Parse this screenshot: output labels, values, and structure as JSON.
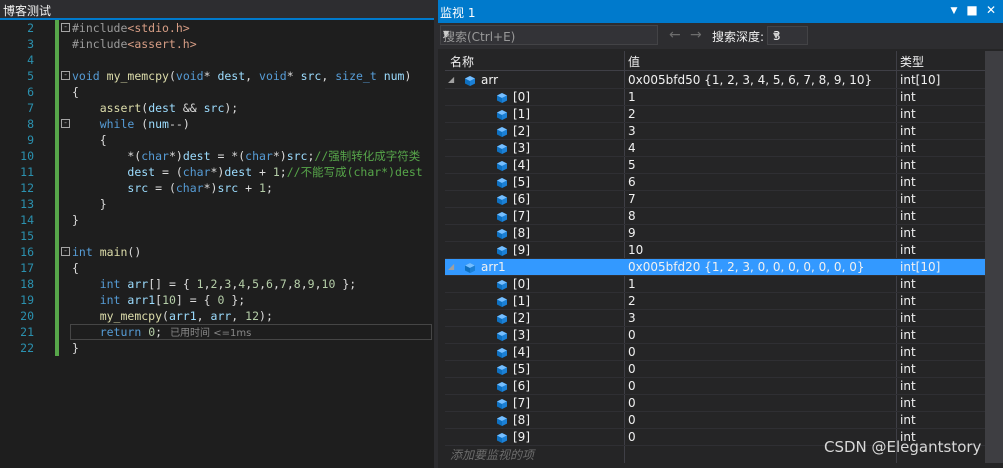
{
  "editor": {
    "tab_title": "博客测试",
    "lines": [
      {
        "n": "2",
        "html": "<span class=\"pp\">#include</span><span class=\"str\">&lt;stdio.h&gt;</span>",
        "fold": "-",
        "chg": true
      },
      {
        "n": "3",
        "html": "<span class=\"pp\">#include</span><span class=\"str\">&lt;assert.h&gt;</span>",
        "fold": "",
        "chg": true
      },
      {
        "n": "4",
        "html": "",
        "fold": "",
        "chg": true
      },
      {
        "n": "5",
        "html": "<span class=\"kw\">void</span> <span class=\"fn\">my_memcpy</span>(<span class=\"kw\">void</span>* <span class=\"id\">dest</span>, <span class=\"kw\">void</span>* <span class=\"id\">src</span>, <span class=\"kw\">size_t</span> <span class=\"id\">num</span>)",
        "fold": "-",
        "chg": true
      },
      {
        "n": "6",
        "html": "{",
        "fold": "",
        "chg": true
      },
      {
        "n": "7",
        "html": "    <span class=\"fn\">assert</span>(<span class=\"id\">dest</span> &amp;&amp; <span class=\"id\">src</span>);",
        "fold": "",
        "chg": true
      },
      {
        "n": "8",
        "html": "    <span class=\"kw\">while</span> (<span class=\"id\">num</span>--)",
        "fold": "-",
        "chg": true
      },
      {
        "n": "9",
        "html": "    {",
        "fold": "",
        "chg": true
      },
      {
        "n": "10",
        "html": "        *(<span class=\"kw\">char</span>*)<span class=\"id\">dest</span> = *(<span class=\"kw\">char</span>*)<span class=\"id\">src</span>;<span class=\"cm\">//强制转化成字符类</span>",
        "fold": "",
        "chg": true
      },
      {
        "n": "11",
        "html": "        <span class=\"id\">dest</span> = (<span class=\"kw\">char</span>*)<span class=\"id\">dest</span> + <span class=\"num\">1</span>;<span class=\"cm\">//不能写成(char*)dest</span>",
        "fold": "",
        "chg": true
      },
      {
        "n": "12",
        "html": "        <span class=\"id\">src</span> = (<span class=\"kw\">char</span>*)<span class=\"id\">src</span> + <span class=\"num\">1</span>;",
        "fold": "",
        "chg": true
      },
      {
        "n": "13",
        "html": "    }",
        "fold": "",
        "chg": true
      },
      {
        "n": "14",
        "html": "}",
        "fold": "",
        "chg": true
      },
      {
        "n": "15",
        "html": "",
        "fold": "",
        "chg": true
      },
      {
        "n": "16",
        "html": "<span class=\"kw\">int</span> <span class=\"fn\">main</span>()",
        "fold": "-",
        "chg": true
      },
      {
        "n": "17",
        "html": "{",
        "fold": "",
        "chg": true
      },
      {
        "n": "18",
        "html": "    <span class=\"kw\">int</span> <span class=\"id\">arr</span>[] = { <span class=\"num\">1</span>,<span class=\"num\">2</span>,<span class=\"num\">3</span>,<span class=\"num\">4</span>,<span class=\"num\">5</span>,<span class=\"num\">6</span>,<span class=\"num\">7</span>,<span class=\"num\">8</span>,<span class=\"num\">9</span>,<span class=\"num\">10</span> };",
        "fold": "",
        "chg": true
      },
      {
        "n": "19",
        "html": "    <span class=\"kw\">int</span> <span class=\"id\">arr1</span>[<span class=\"num\">10</span>] = { <span class=\"num\">0</span> };",
        "fold": "",
        "chg": true
      },
      {
        "n": "20",
        "html": "    <span class=\"fn\">my_memcpy</span>(<span class=\"id\">arr1</span>, <span class=\"id\">arr</span>, <span class=\"num\">12</span>);",
        "fold": "",
        "chg": true
      },
      {
        "n": "21",
        "html": "    <span class=\"kw\">return</span> <span class=\"num\">0</span>;",
        "fold": "",
        "chg": true
      },
      {
        "n": "22",
        "html": "}",
        "fold": "",
        "chg": true
      }
    ],
    "elapsed_hint": "已用时间 <=1ms"
  },
  "watch": {
    "title": "监视 1",
    "search_placeholder": "搜索(Ctrl+E)",
    "depth_label": "搜索深度:",
    "depth_value": "3",
    "columns": {
      "name": "名称",
      "value": "值",
      "type": "类型"
    },
    "add_placeholder": "添加要监视的项",
    "rows": [
      {
        "name": "arr",
        "value": "0x005bfd50 {1, 2, 3, 4, 5, 6, 7, 8, 9, 10}",
        "type": "int[10]",
        "level": 0,
        "expanded": true,
        "selected": false
      },
      {
        "name": "[0]",
        "value": "1",
        "type": "int",
        "level": 1
      },
      {
        "name": "[1]",
        "value": "2",
        "type": "int",
        "level": 1
      },
      {
        "name": "[2]",
        "value": "3",
        "type": "int",
        "level": 1
      },
      {
        "name": "[3]",
        "value": "4",
        "type": "int",
        "level": 1
      },
      {
        "name": "[4]",
        "value": "5",
        "type": "int",
        "level": 1
      },
      {
        "name": "[5]",
        "value": "6",
        "type": "int",
        "level": 1
      },
      {
        "name": "[6]",
        "value": "7",
        "type": "int",
        "level": 1
      },
      {
        "name": "[7]",
        "value": "8",
        "type": "int",
        "level": 1
      },
      {
        "name": "[8]",
        "value": "9",
        "type": "int",
        "level": 1
      },
      {
        "name": "[9]",
        "value": "10",
        "type": "int",
        "level": 1
      },
      {
        "name": "arr1",
        "value": "0x005bfd20 {1, 2, 3, 0, 0, 0, 0, 0, 0, 0}",
        "type": "int[10]",
        "level": 0,
        "expanded": true,
        "selected": true
      },
      {
        "name": "[0]",
        "value": "1",
        "type": "int",
        "level": 1
      },
      {
        "name": "[1]",
        "value": "2",
        "type": "int",
        "level": 1
      },
      {
        "name": "[2]",
        "value": "3",
        "type": "int",
        "level": 1
      },
      {
        "name": "[3]",
        "value": "0",
        "type": "int",
        "level": 1
      },
      {
        "name": "[4]",
        "value": "0",
        "type": "int",
        "level": 1
      },
      {
        "name": "[5]",
        "value": "0",
        "type": "int",
        "level": 1
      },
      {
        "name": "[6]",
        "value": "0",
        "type": "int",
        "level": 1
      },
      {
        "name": "[7]",
        "value": "0",
        "type": "int",
        "level": 1
      },
      {
        "name": "[8]",
        "value": "0",
        "type": "int",
        "level": 1
      },
      {
        "name": "[9]",
        "value": "0",
        "type": "int",
        "level": 1
      }
    ]
  },
  "watermark": "CSDN @Elegantstory"
}
